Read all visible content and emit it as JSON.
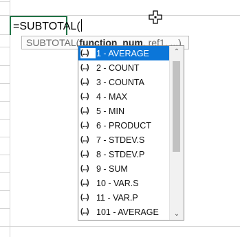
{
  "formula_bar": {
    "text": "=SUBTOTAL("
  },
  "tooltip": {
    "fn": "SUBTOTAL(",
    "arg_bold": "function_num",
    "rest": ", ref1, ...)"
  },
  "autocomplete": {
    "icon_glyph": "(...)",
    "selected_index": 0,
    "items": [
      "1 - AVERAGE",
      "2 - COUNT",
      "3 - COUNTA",
      "4 - MAX",
      "5 - MIN",
      "6 - PRODUCT",
      "7 - STDEV.S",
      "8 - STDEV.P",
      "9 - SUM",
      "10 - VAR.S",
      "11 - VAR.P",
      "101 - AVERAGE"
    ]
  },
  "colors": {
    "selection": "#0b76d9",
    "cell_border": "#217346"
  }
}
